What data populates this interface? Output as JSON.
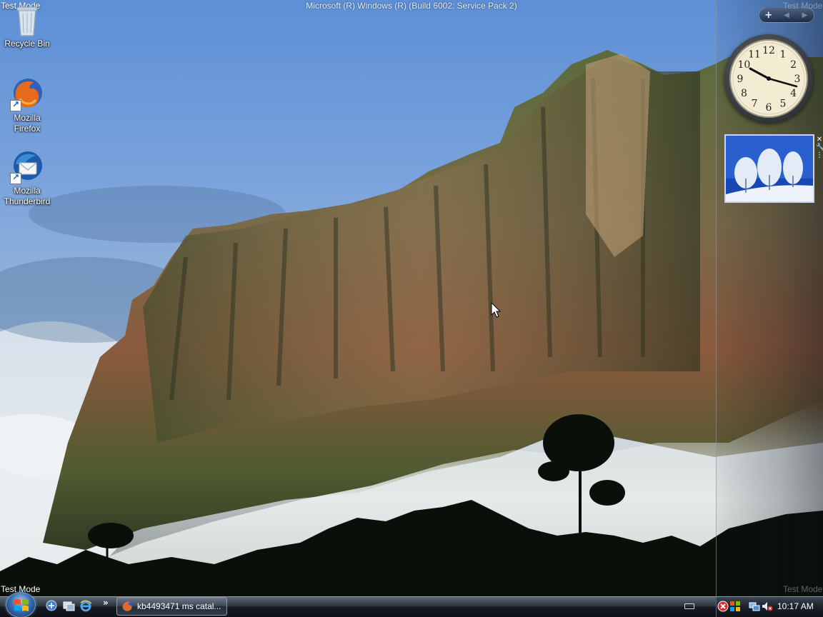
{
  "desktop": {
    "watermark_title": "Microsoft (R) Windows (R) (Build 6002: Service Pack 2)",
    "test_mode_label": "Test Mode",
    "icons": [
      {
        "label": "Recycle Bin",
        "icon": "recycle-bin-icon"
      },
      {
        "label": "Mozilla Firefox",
        "icon": "firefox-icon"
      },
      {
        "label": "Mozilla Thunderbird",
        "icon": "thunderbird-icon"
      }
    ]
  },
  "sidebar": {
    "add_gadget_symbol": "+",
    "clock_numbers": [
      "12",
      "1",
      "2",
      "3",
      "4",
      "5",
      "6",
      "7",
      "8",
      "9",
      "10",
      "11"
    ],
    "slideshow_subject": "snow-trees"
  },
  "taskbar": {
    "quick_launch": [
      "switch-windows-icon",
      "show-desktop-icon",
      "internet-explorer-icon"
    ],
    "more_symbol": "»",
    "task_button_label": "kb4493471 ms catal...",
    "clock": "10:17 AM"
  },
  "colors": {
    "taskbar_dark": "#161b22",
    "start_orb": "#3a6fb3",
    "sky": "#5d8fd6"
  }
}
